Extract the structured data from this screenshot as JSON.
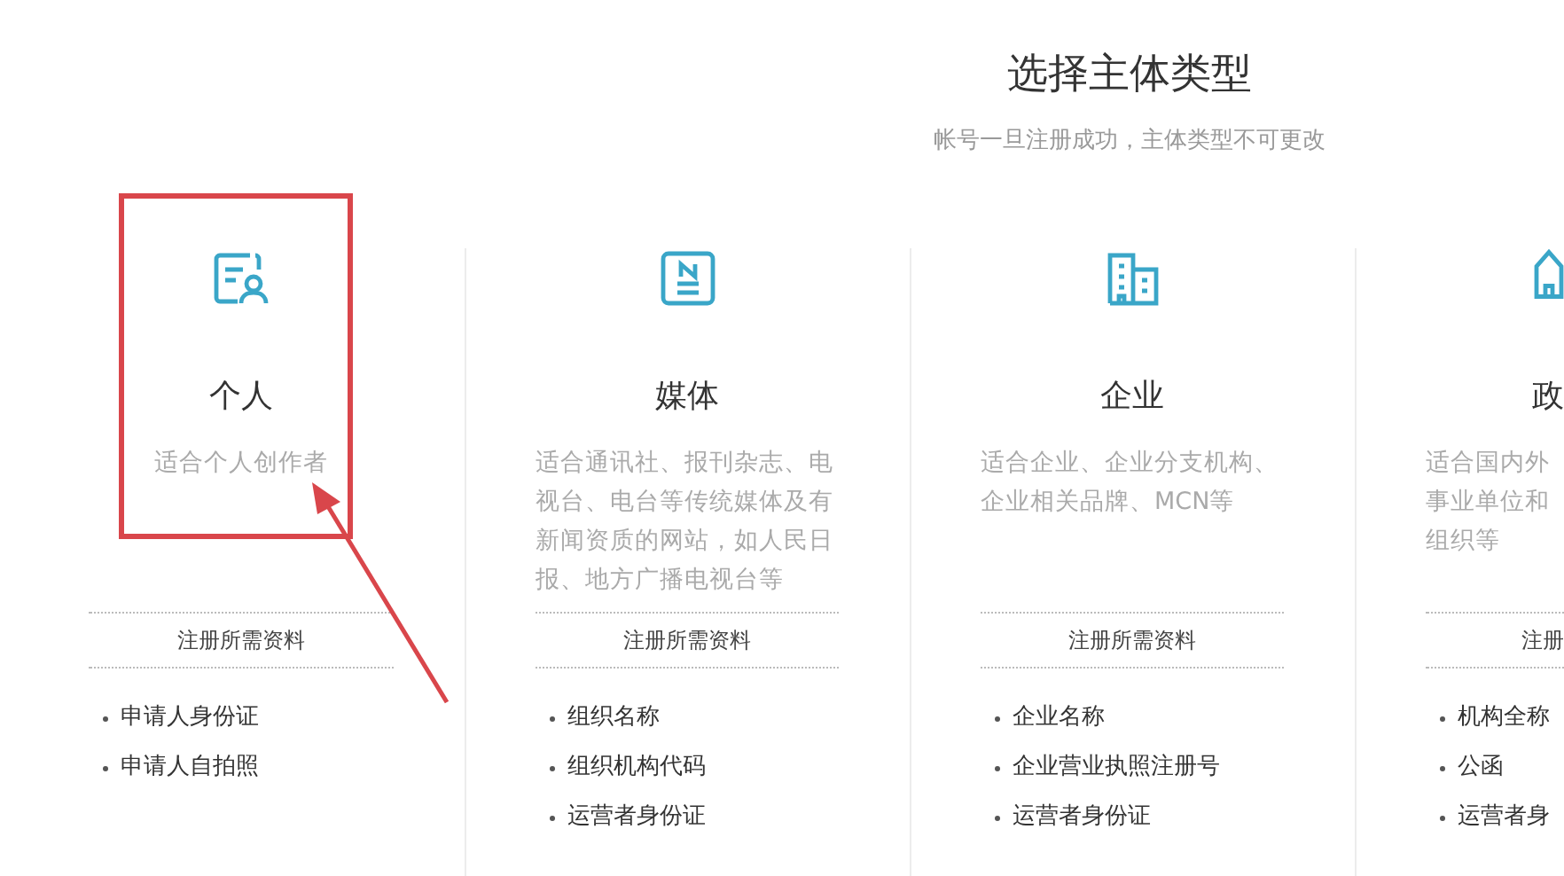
{
  "header": {
    "title": "选择主体类型",
    "subtitle": "帐号一旦注册成功，主体类型不可更改"
  },
  "types": [
    {
      "kind": "person",
      "title": "个人",
      "description": [
        "适合个人创作者"
      ],
      "requirements_title": "注册所需资料",
      "requirements": [
        "申请人身份证",
        "申请人自拍照"
      ],
      "highlighted": true
    },
    {
      "kind": "media",
      "title": "媒体",
      "description": [
        "适合通讯社、报刊杂志、电",
        "视台、电台等传统媒体及有",
        "新闻资质的网站，如人民日",
        "报、地方广播电视台等"
      ],
      "requirements_title": "注册所需资料",
      "requirements": [
        "组织名称",
        "组织机构代码",
        "运营者身份证"
      ],
      "highlighted": false
    },
    {
      "kind": "company",
      "title": "企业",
      "description": [
        "适合企业、企业分支机构、",
        "企业相关品牌、MCN等"
      ],
      "requirements_title": "注册所需资料",
      "requirements": [
        "企业名称",
        "企业营业执照注册号",
        "运营者身份证"
      ],
      "highlighted": false
    },
    {
      "kind": "government",
      "title": "政",
      "description": [
        "适合国内外",
        "事业单位和",
        "组织等"
      ],
      "requirements_title": "注册",
      "requirements": [
        "机构全称",
        "公函",
        "运营者身"
      ],
      "highlighted": false
    }
  ]
}
